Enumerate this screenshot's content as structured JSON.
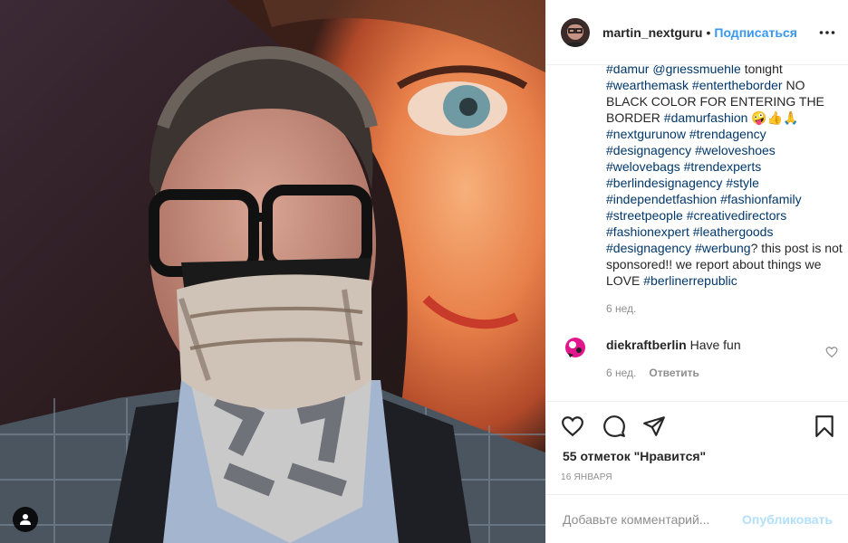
{
  "post": {
    "author": "martin_nextguru",
    "separator": "•",
    "follow_label": "Подписаться",
    "caption_lines": [
      {
        "text": "#damur @griessmuehle ",
        "plain": false
      },
      {
        "text": "tonight",
        "plain": true
      },
      {
        "text": " #wearthemask #entertheborder ",
        "plain": false
      },
      {
        "text": "NO BLACK COLOR FOR ENTERING THE BORDER ",
        "plain": true
      },
      {
        "text": "#damurfashion ",
        "plain": false
      },
      {
        "text": "🤪👍🙏",
        "plain": true
      },
      {
        "text": " #nextgurunow #trendagency #designagency #weloveshoes #welovebags #trendexperts #berlindesignagency #style #independetfashion #fashionfamily #streetpeople #creativedirectors #fashionexpert #leathergoods #designagency #werbung",
        "plain": false
      },
      {
        "text": "? this post is not sponsored!! we report about things we LOVE ",
        "plain": true
      },
      {
        "text": "#berlinerrepublic",
        "plain": false
      }
    ],
    "caption_time": "6 нед.",
    "likes": "55 отметок \"Нравится\"",
    "date": "16 ЯНВАРЯ"
  },
  "comment": {
    "username": "diekraftberlin",
    "text": " Have fun",
    "time": "6 нед.",
    "reply_label": "Ответить"
  },
  "composer": {
    "placeholder": "Добавьте комментарий...",
    "publish_label": "Опубликовать"
  },
  "icons": {
    "like": "heart-icon",
    "comment": "comment-icon",
    "share": "paper-plane-icon",
    "save": "bookmark-icon",
    "more": "more-options-icon",
    "tag": "user-tag-icon"
  },
  "colors": {
    "link": "#00376b",
    "accent": "#3897f0",
    "publish_disabled": "#b2dffc",
    "muted": "#8e8e8e"
  }
}
